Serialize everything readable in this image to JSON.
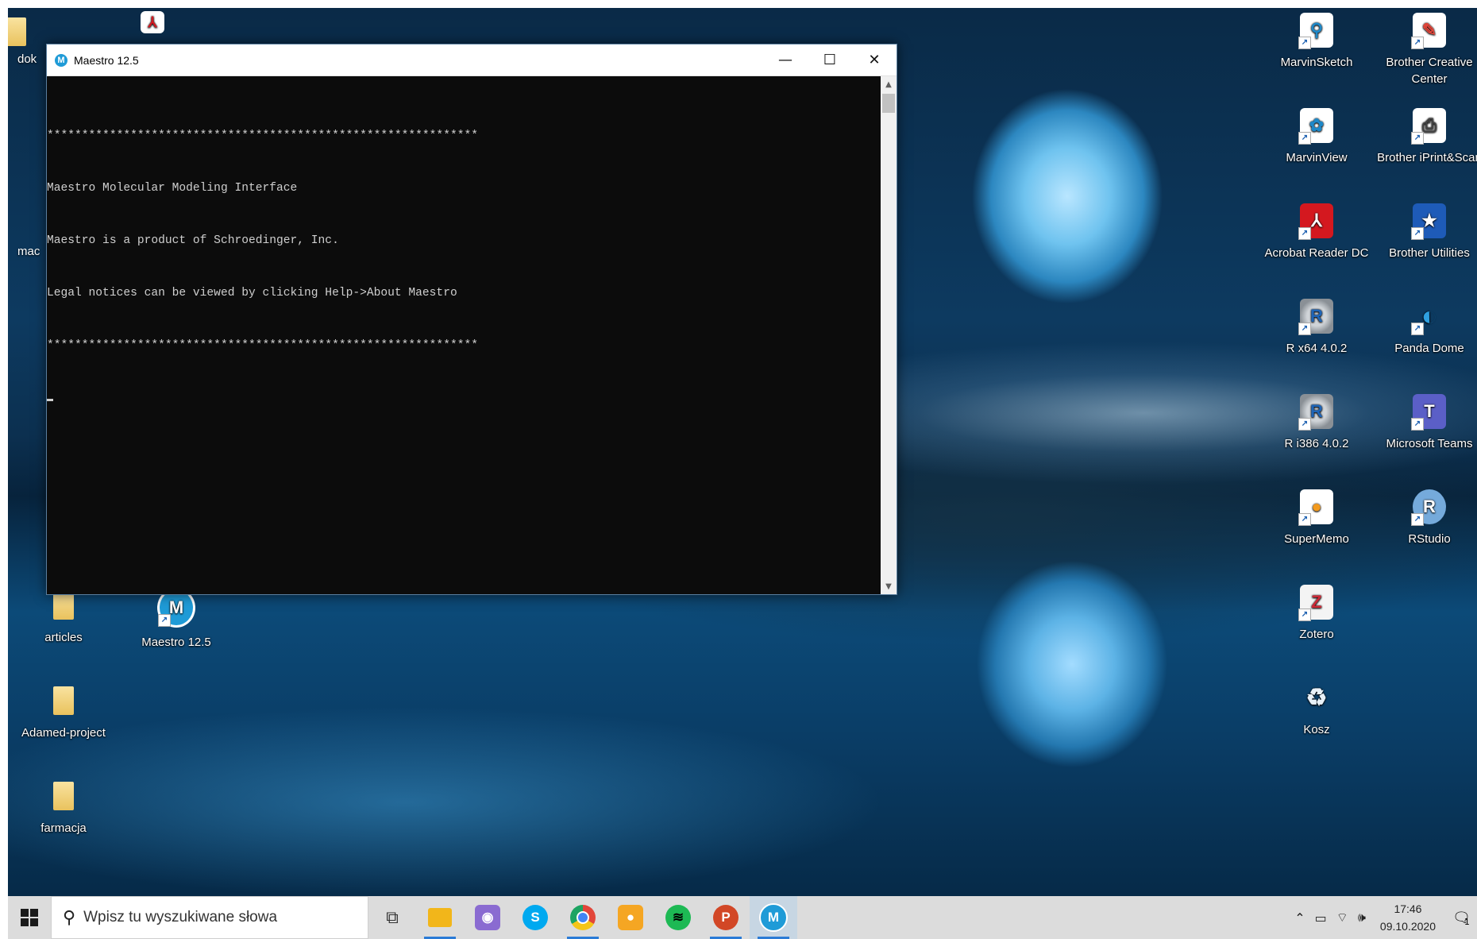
{
  "window": {
    "title": "Maestro 12.5",
    "icon_letter": "M",
    "minimize": "—",
    "maximize": "☐",
    "close": "✕",
    "console_lines": [
      "**************************************************************",
      "Maestro Molecular Modeling Interface",
      "Maestro is a product of Schroedinger, Inc.",
      "Legal notices can be viewed by clicking Help->About Maestro",
      "**************************************************************"
    ],
    "scroll_up": "▲",
    "scroll_down": "▼"
  },
  "desktop": {
    "partial_left": [
      "dok",
      "mac"
    ],
    "left_icons": [
      {
        "label": "articles",
        "icon": "folder-icon"
      },
      {
        "label": "Maestro 12.5",
        "icon": "maestro-icon"
      },
      {
        "label": "Adamed-project",
        "icon": "folder-icon"
      },
      {
        "label": "farmacja",
        "icon": "folder-icon"
      }
    ],
    "right_icons": [
      {
        "label": "MarvinSketch",
        "icon": "marvinsketch-icon",
        "color": "#ffffff"
      },
      {
        "label": "Brother Creative Center",
        "label2": "Center",
        "icon": "brother-creative-icon",
        "color": "#ffffff"
      },
      {
        "label": "MarvinView",
        "icon": "marvinview-icon",
        "color": "#ffffff"
      },
      {
        "label": "Brother iPrint&Scan",
        "icon": "brother-iprint-icon",
        "color": "#ffffff"
      },
      {
        "label": "Acrobat Reader DC",
        "icon": "acrobat-icon",
        "color": "#d4181f"
      },
      {
        "label": "Brother Utilities",
        "icon": "brother-utilities-icon",
        "color": "#1e5bb8"
      },
      {
        "label": "R x64 4.0.2",
        "icon": "r-icon",
        "color": "#1f65b7"
      },
      {
        "label": "Panda Dome",
        "icon": "panda-dome-icon",
        "color": "#2fa0e0"
      },
      {
        "label": "R i386 4.0.2",
        "icon": "r-icon",
        "color": "#1f65b7"
      },
      {
        "label": "Microsoft Teams",
        "icon": "teams-icon",
        "color": "#5b5fc7"
      },
      {
        "label": "SuperMemo",
        "icon": "supermemo-icon",
        "color": "#f39a1e"
      },
      {
        "label": "RStudio",
        "icon": "rstudio-icon",
        "color": "#75aadb"
      },
      {
        "label": "Zotero",
        "icon": "zotero-icon",
        "color": "#cc2936"
      },
      {
        "label": "Kosz",
        "icon": "recycle-bin-icon",
        "color": "#e8f1f8"
      }
    ]
  },
  "taskbar": {
    "search_placeholder": "Wpisz tu wyszukiwane słowa",
    "apps": [
      {
        "name": "task-view",
        "glyph": "⧉",
        "color": "#333333"
      },
      {
        "name": "file-explorer",
        "glyph": "▬",
        "color": "#f2b61a"
      },
      {
        "name": "photo-app",
        "glyph": "◉",
        "color": "#8a6bd1"
      },
      {
        "name": "skype",
        "glyph": "S",
        "color": "#00a9f0"
      },
      {
        "name": "chrome",
        "glyph": "●",
        "color": "#e2463a"
      },
      {
        "name": "supermemo",
        "glyph": "●",
        "color": "#f5a623"
      },
      {
        "name": "spotify",
        "glyph": "≋",
        "color": "#1db954"
      },
      {
        "name": "powerpoint",
        "glyph": "P",
        "color": "#d24726"
      },
      {
        "name": "maestro",
        "glyph": "M",
        "color": "#1f9bd7"
      }
    ],
    "time": "17:46",
    "date": "09.10.2020",
    "notification_count": "1"
  }
}
